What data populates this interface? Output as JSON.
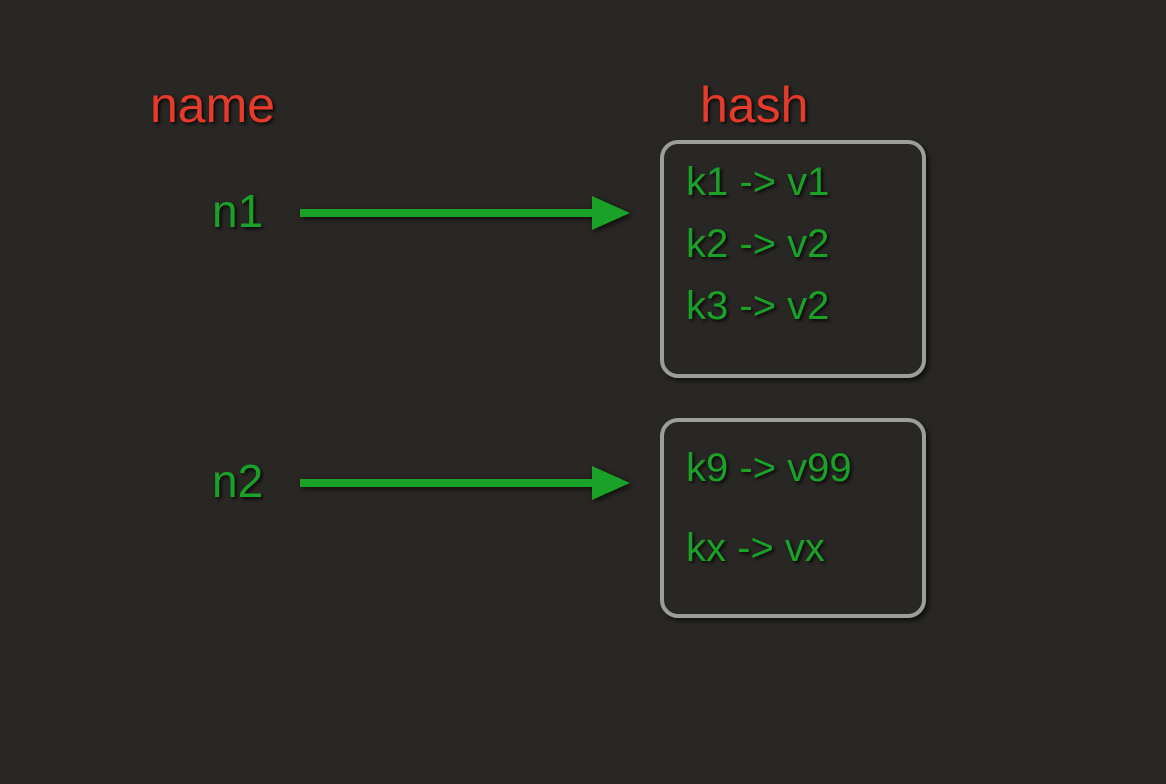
{
  "headers": {
    "name": "name",
    "hash": "hash"
  },
  "rows": [
    {
      "key": "n1",
      "entries": [
        {
          "k": "k1",
          "v": "v1"
        },
        {
          "k": "k2",
          "v": "v2"
        },
        {
          "k": "k3",
          "v": "v2"
        }
      ]
    },
    {
      "key": "n2",
      "entries": [
        {
          "k": "k9",
          "v": "v99"
        },
        {
          "k": "kx",
          "v": "vx"
        }
      ]
    }
  ],
  "colors": {
    "background": "#292724",
    "heading": "#e63b2a",
    "value": "#1aa228",
    "boxBorder": "#9d9d9b",
    "arrow": "#1aa228"
  }
}
